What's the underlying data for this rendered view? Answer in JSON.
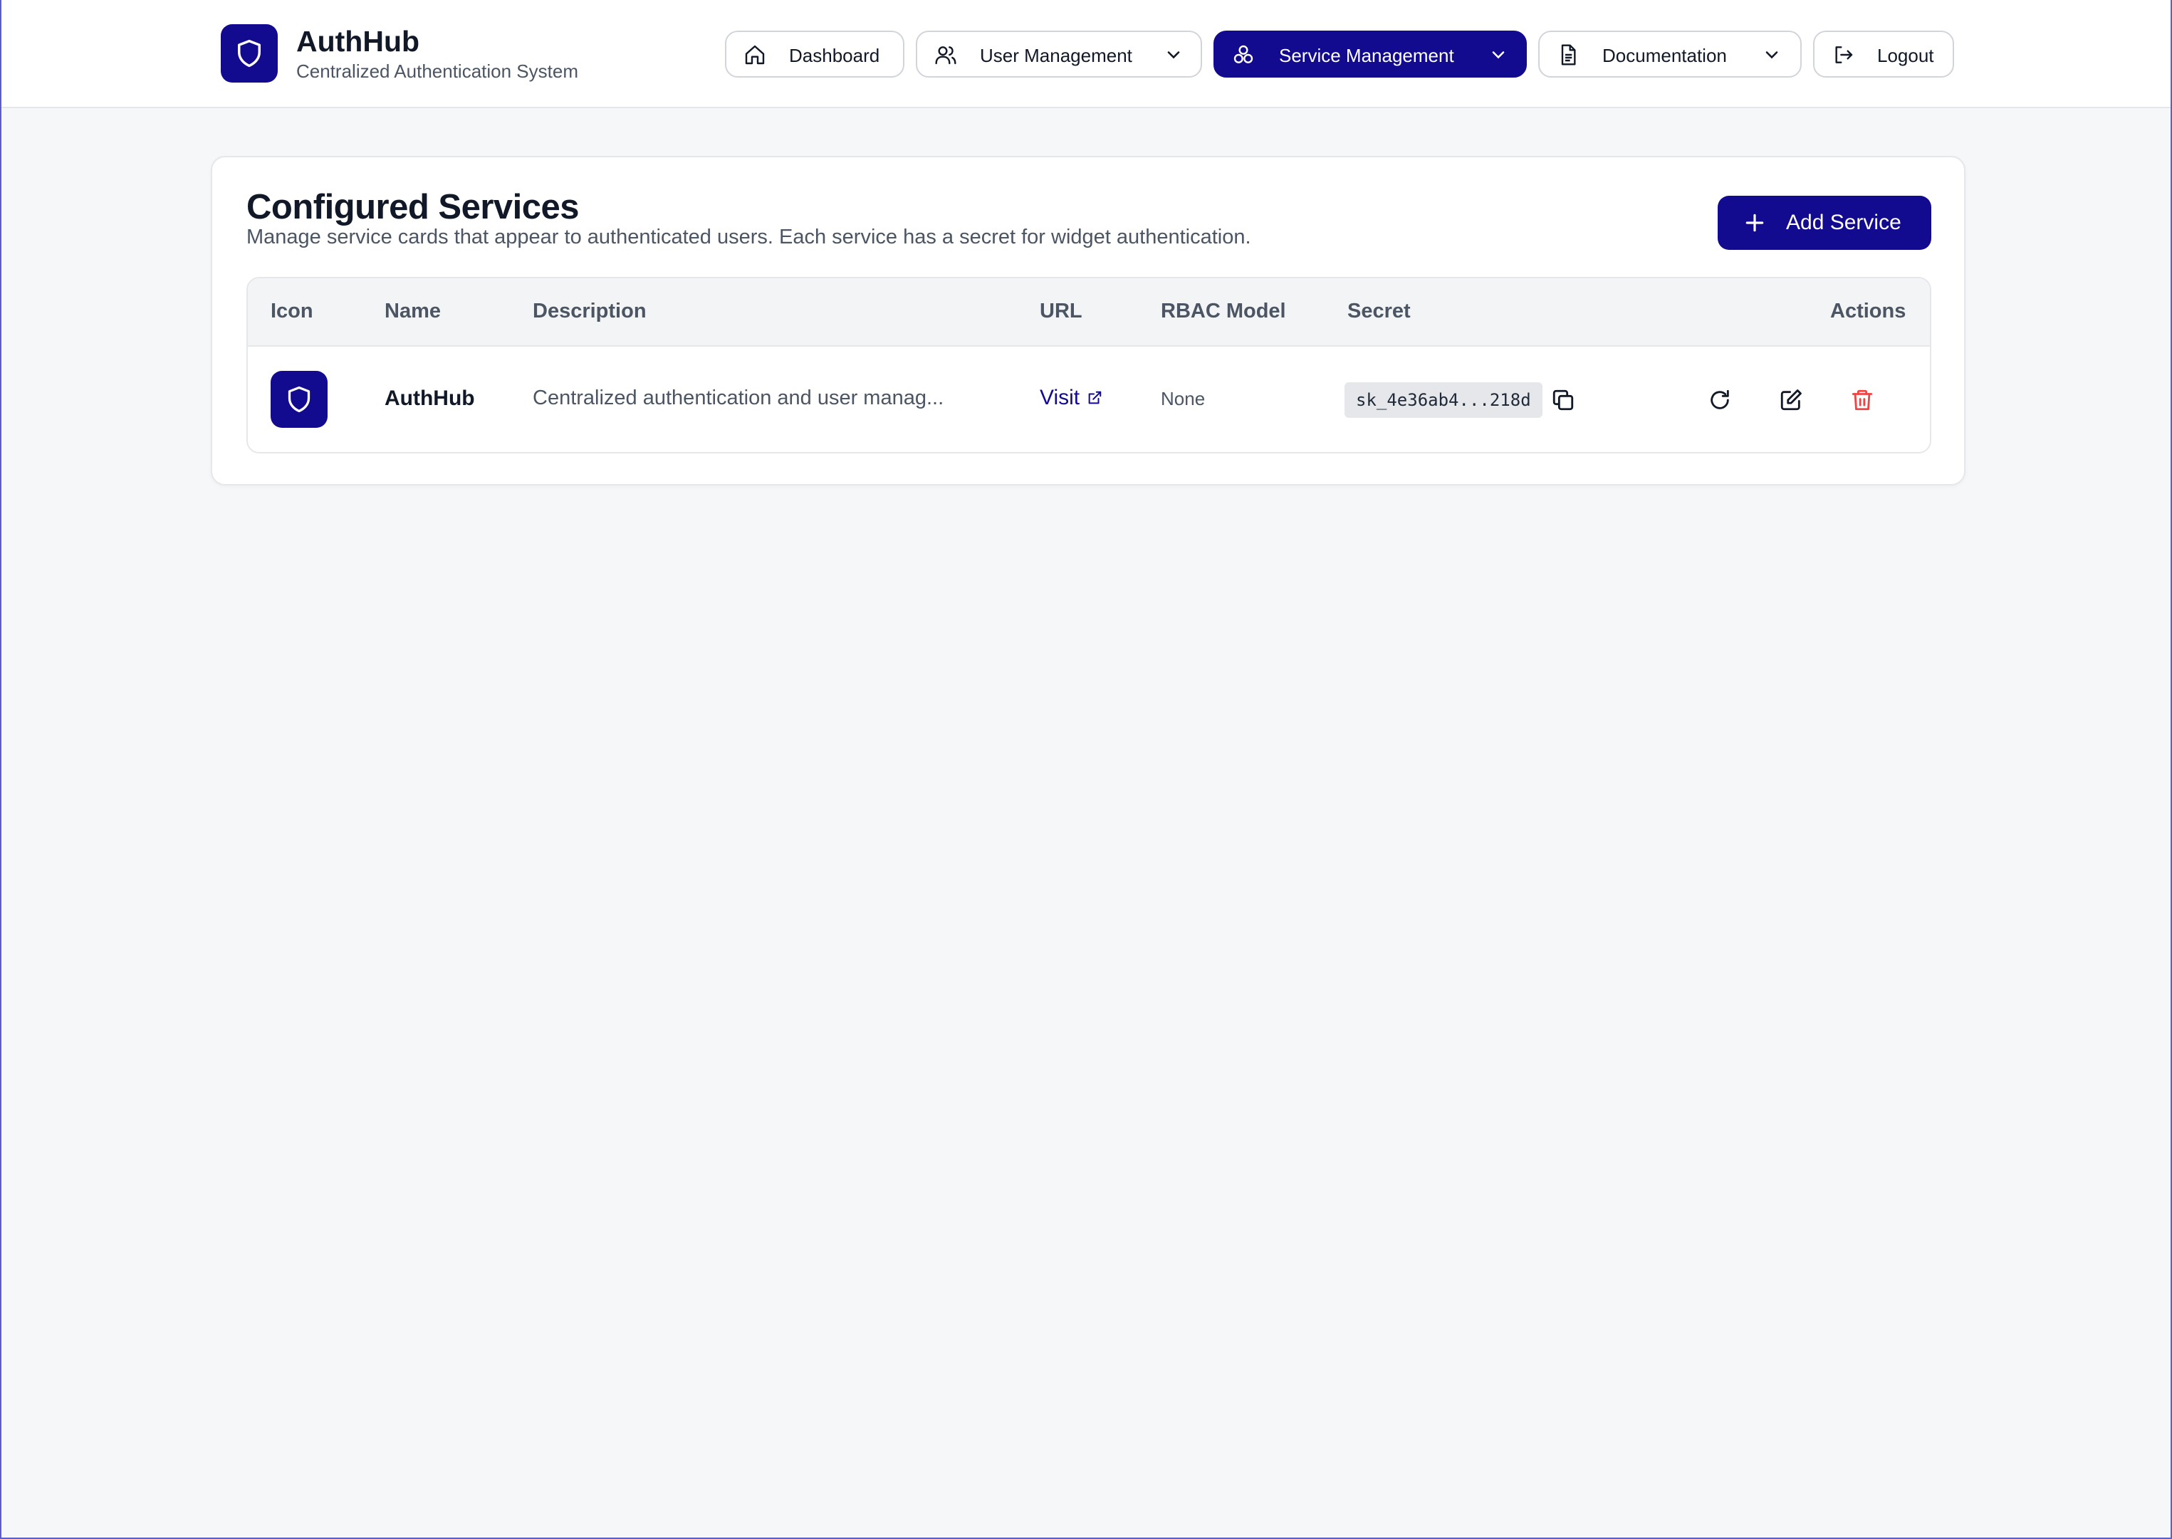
{
  "brand": {
    "title": "AuthHub",
    "subtitle": "Centralized Authentication System",
    "logo_icon": "shield-icon",
    "color": "#120a8f"
  },
  "nav": {
    "dashboard": {
      "label": "Dashboard",
      "icon": "home-icon"
    },
    "user_management": {
      "label": "User Management",
      "icon": "users-icon"
    },
    "service_management": {
      "label": "Service Management",
      "icon": "services-icon",
      "active": true
    },
    "documentation": {
      "label": "Documentation",
      "icon": "document-icon"
    },
    "logout": {
      "label": "Logout",
      "icon": "logout-icon"
    }
  },
  "page": {
    "title": "Configured Services",
    "description": "Manage service cards that appear to authenticated users. Each service has a secret for widget authentication.",
    "add_button": "Add Service"
  },
  "table": {
    "columns": [
      "Icon",
      "Name",
      "Description",
      "URL",
      "RBAC Model",
      "Secret",
      "Actions"
    ],
    "rows": [
      {
        "icon": "shield-icon",
        "name": "AuthHub",
        "description": "Centralized authentication and user manag...",
        "url_label": "Visit",
        "rbac": "None",
        "secret": "sk_4e36ab4...218d",
        "actions": [
          "copy-icon",
          "refresh-icon",
          "edit-icon",
          "delete-icon"
        ]
      }
    ]
  },
  "colors": {
    "primary": "#120a8f",
    "danger": "#ef4444",
    "background": "#f6f7f9"
  }
}
